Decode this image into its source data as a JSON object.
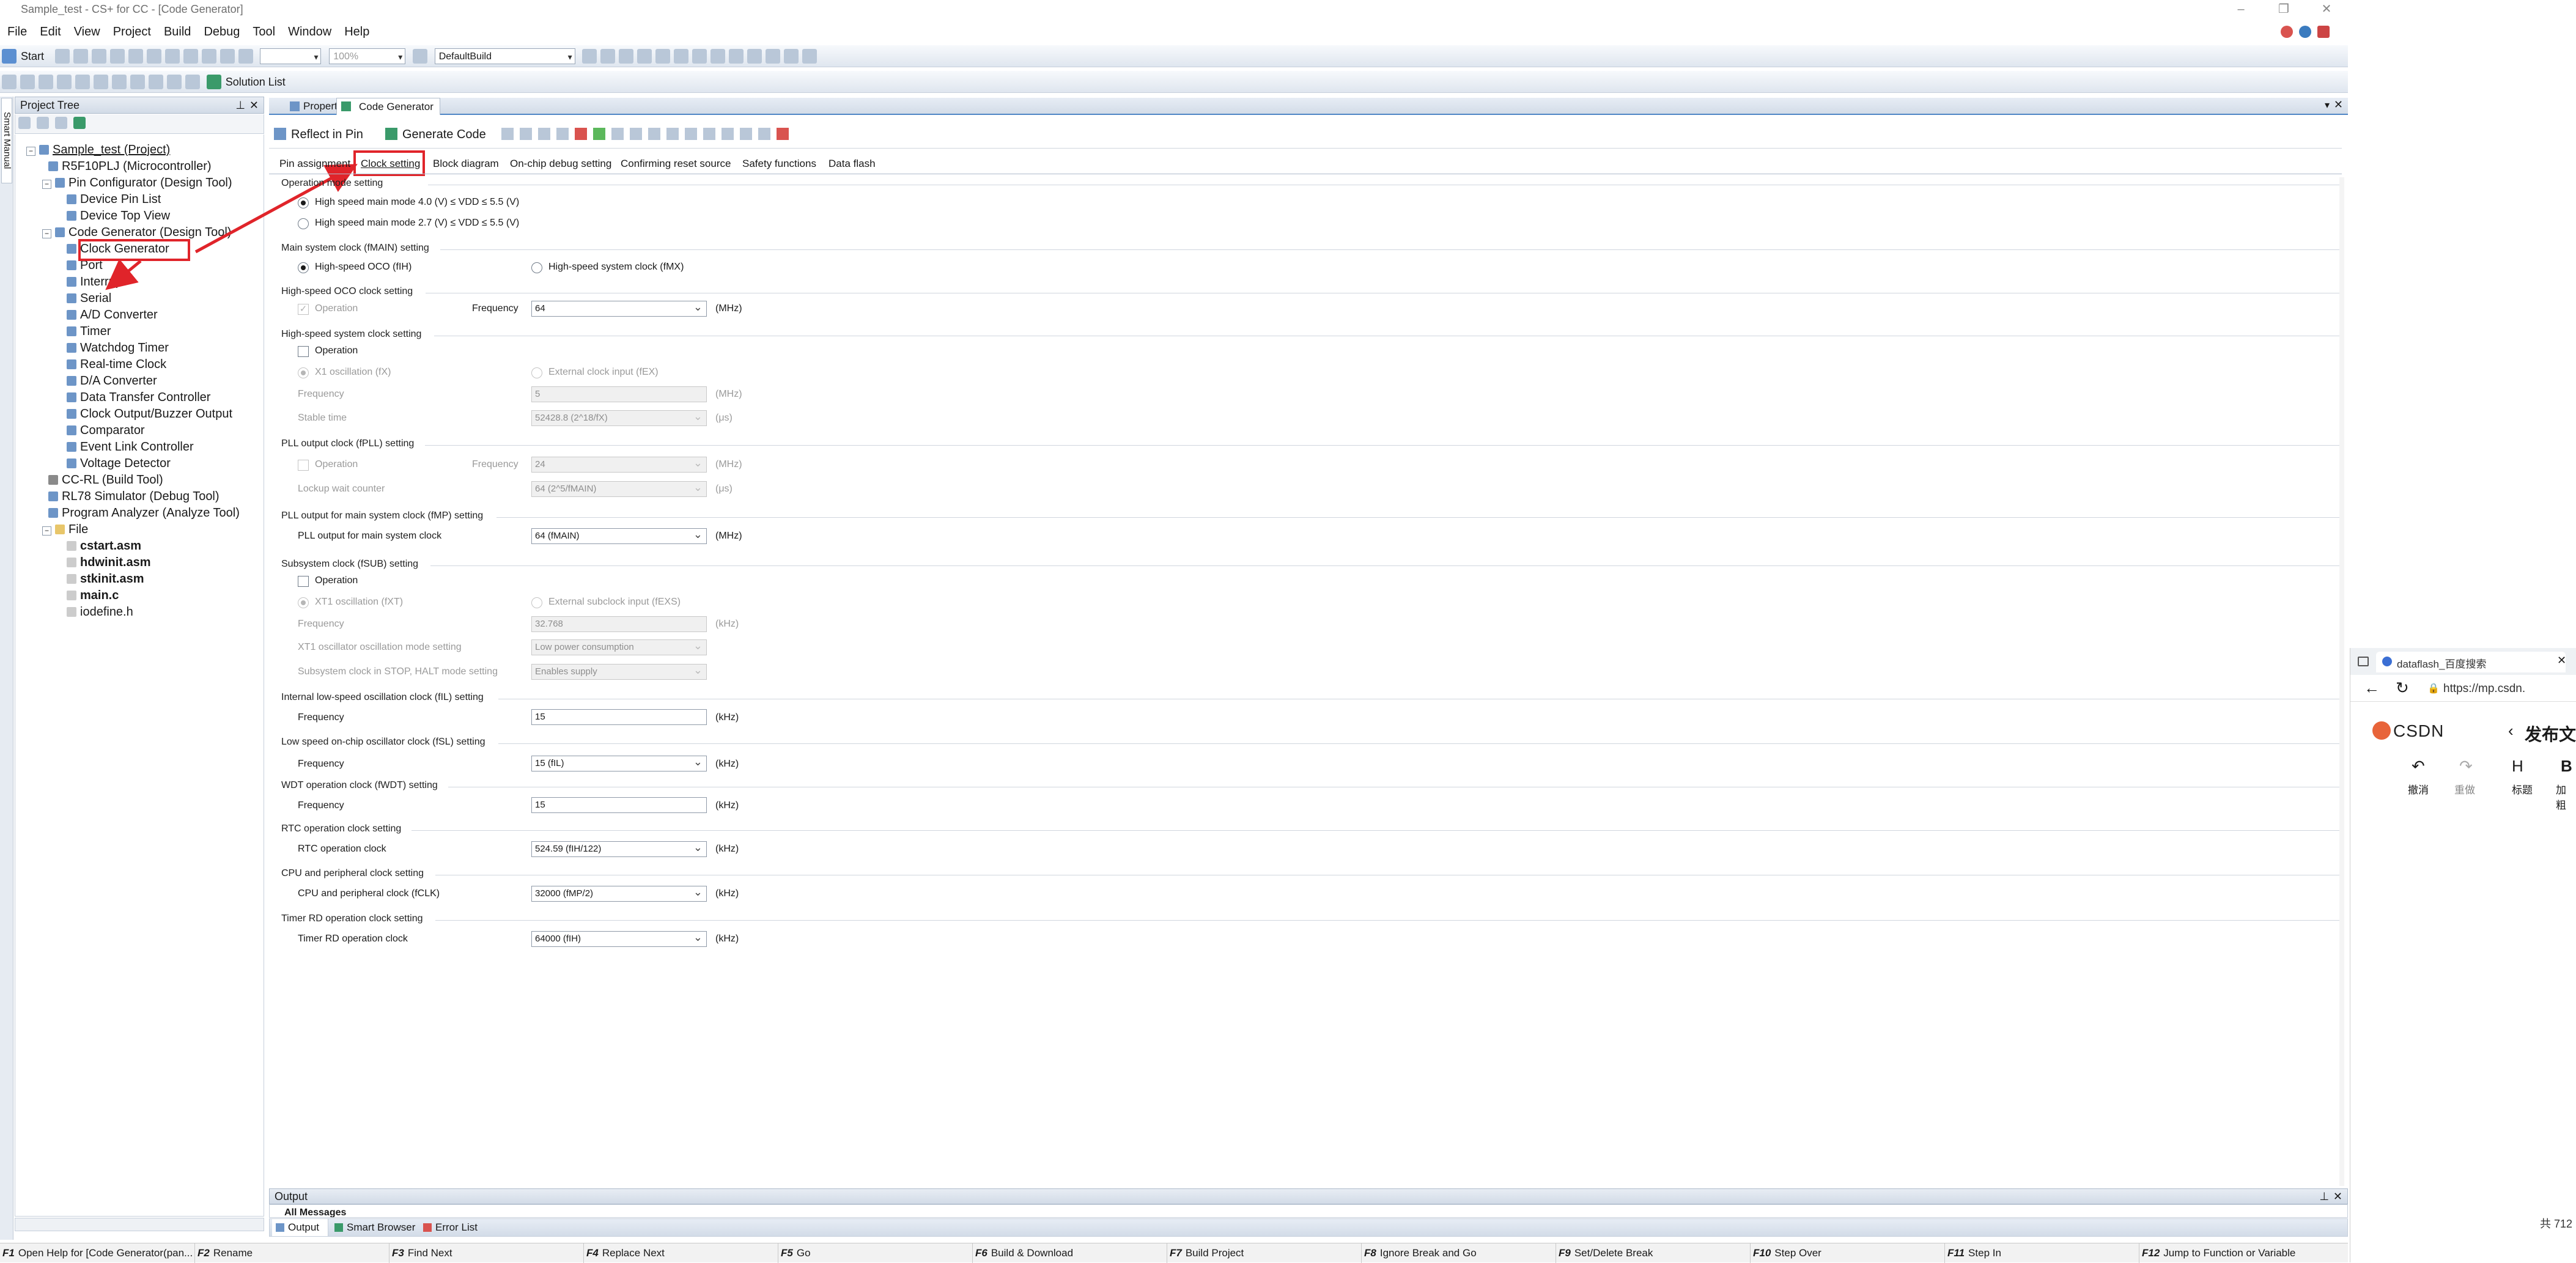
{
  "window": {
    "title": "Sample_test - CS+ for CC - [Code Generator]"
  },
  "menu": [
    "File",
    "Edit",
    "View",
    "Project",
    "Build",
    "Debug",
    "Tool",
    "Window",
    "Help"
  ],
  "toolbar": {
    "start_label": "Start",
    "zoom": "100%",
    "build_config": "DefaultBuild",
    "solution_list": "Solution List"
  },
  "project_tree": {
    "title": "Project Tree",
    "items": [
      "Sample_test (Project)",
      "R5F10PLJ (Microcontroller)",
      "Pin Configurator (Design Tool)",
      "Device Pin List",
      "Device Top View",
      "Code Generator (Design Tool)",
      "Clock Generator",
      "Port",
      "Interrupt",
      "Serial",
      "A/D Converter",
      "Timer",
      "Watchdog Timer",
      "Real-time Clock",
      "D/A Converter",
      "Data Transfer Controller",
      "Clock Output/Buzzer Output",
      "Comparator",
      "Event Link Controller",
      "Voltage Detector",
      "CC-RL (Build Tool)",
      "RL78 Simulator (Debug Tool)",
      "Program Analyzer (Analyze Tool)",
      "File",
      "cstart.asm",
      "hdwinit.asm",
      "stkinit.asm",
      "main.c",
      "iodefine.h"
    ]
  },
  "side_tab": "Smart Manual",
  "doc_tabs": [
    "Property",
    "Code Generator"
  ],
  "cg_toolbar": {
    "reflect": "Reflect in Pin",
    "generate": "Generate Code"
  },
  "sub_tabs": [
    "Pin assignment",
    "Clock setting",
    "Block diagram",
    "On-chip debug setting",
    "Confirming reset source",
    "Safety functions",
    "Data flash"
  ],
  "form": {
    "op_mode": {
      "title": "Operation mode setting",
      "opt1": "High speed main mode 4.0 (V) ≤ VDD ≤ 5.5 (V)",
      "opt2": "High speed main mode 2.7 (V) ≤ VDD ≤ 5.5 (V)"
    },
    "main_clock": {
      "title": "Main system clock (fMAIN) setting",
      "opt1": "High-speed OCO (fIH)",
      "opt2": "High-speed system clock (fMX)"
    },
    "oco": {
      "title": "High-speed OCO clock setting",
      "operation": "Operation",
      "freq_label": "Frequency",
      "freq": "64",
      "unit": "(MHz)"
    },
    "hs_sys": {
      "title": "High-speed system clock setting",
      "operation": "Operation",
      "x1": "X1 oscillation (fX)",
      "ext": "External clock input (fEX)",
      "freq_label": "Frequency",
      "freq": "5",
      "freq_unit": "(MHz)",
      "stable_label": "Stable time",
      "stable": "52428.8 (2^18/fX)",
      "stable_unit": "(μs)"
    },
    "pll": {
      "title": "PLL output clock (fPLL) setting",
      "operation": "Operation",
      "freq_label": "Frequency",
      "freq": "24",
      "freq_unit": "(MHz)",
      "lockup_label": "Lockup wait counter",
      "lockup": "64 (2^5/fMAIN)",
      "lockup_unit": "(μs)"
    },
    "pll_main": {
      "title": "PLL output for main system clock (fMP) setting",
      "label": "PLL output for main system clock",
      "value": "64 (fMAIN)",
      "unit": "(MHz)"
    },
    "subsys": {
      "title": "Subsystem clock (fSUB) setting",
      "operation": "Operation",
      "xt1": "XT1 oscillation (fXT)",
      "ext": "External subclock input (fEXS)",
      "freq_label": "Frequency",
      "freq": "32.768",
      "freq_unit": "(kHz)",
      "xt1_mode_label": "XT1 oscillator oscillation mode setting",
      "xt1_mode": "Low power consumption",
      "stop_label": "Subsystem clock in STOP, HALT mode setting",
      "stop": "Enables supply"
    },
    "fil": {
      "title": "Internal low-speed oscillation clock (fIL) setting",
      "label": "Frequency",
      "value": "15",
      "unit": "(kHz)"
    },
    "fsl": {
      "title": "Low speed on-chip oscillator clock (fSL) setting",
      "label": "Frequency",
      "value": "15 (fIL)",
      "unit": "(kHz)"
    },
    "wdt": {
      "title": "WDT operation clock (fWDT) setting",
      "label": "Frequency",
      "value": "15",
      "unit": "(kHz)"
    },
    "rtc": {
      "title": "RTC operation clock setting",
      "label": "RTC operation clock",
      "value": "524.59 (fIH/122)",
      "unit": "(kHz)"
    },
    "cpu": {
      "title": "CPU and peripheral clock setting",
      "label": "CPU and peripheral clock (fCLK)",
      "value": "32000 (fMP/2)",
      "unit": "(kHz)"
    },
    "trd": {
      "title": "Timer RD operation clock setting",
      "label": "Timer RD operation clock",
      "value": "64000 (fIH)",
      "unit": "(kHz)"
    }
  },
  "output": {
    "title": "Output",
    "msg": "All Messages",
    "tabs": [
      "Output",
      "Smart Browser",
      "Error List"
    ]
  },
  "fkeys": [
    {
      "key": "F1",
      "label": "Open Help for [Code Generator(pan..."
    },
    {
      "key": "F2",
      "label": "Rename"
    },
    {
      "key": "F3",
      "label": "Find Next"
    },
    {
      "key": "F4",
      "label": "Replace Next"
    },
    {
      "key": "F5",
      "label": "Go"
    },
    {
      "key": "F6",
      "label": "Build & Download"
    },
    {
      "key": "F7",
      "label": "Build Project"
    },
    {
      "key": "F8",
      "label": "Ignore Break and Go"
    },
    {
      "key": "F9",
      "label": "Set/Delete Break"
    },
    {
      "key": "F10",
      "label": "Step Over"
    },
    {
      "key": "F11",
      "label": "Step In"
    },
    {
      "key": "F12",
      "label": "Jump to Function or Variable"
    }
  ],
  "browser": {
    "tab_title": "dataflash_百度搜索",
    "url": "https://mp.csdn.",
    "brand": "CSDN",
    "page_title": "发布文",
    "undo": "撤消",
    "redo": "重做",
    "heading": "标题",
    "bold_hint": "加粗",
    "h_label": "H",
    "b_label": "B",
    "count": "共 712"
  },
  "colors": {
    "accent": "#3a7bbf",
    "highlight": "#e0242a"
  }
}
